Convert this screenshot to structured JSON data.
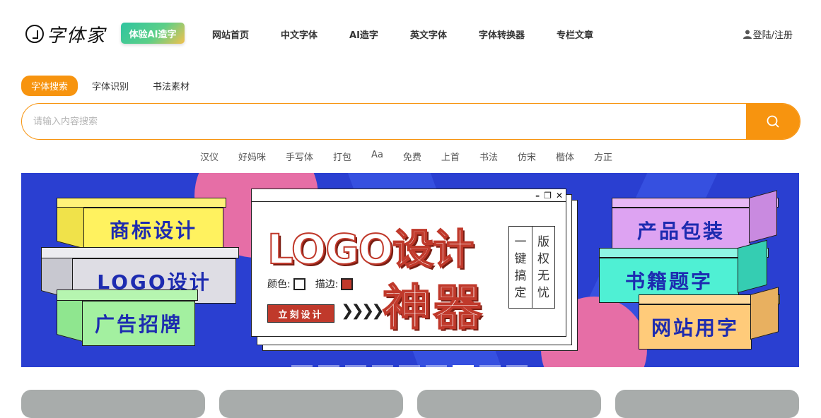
{
  "header": {
    "logo_text": "字体家",
    "ai_badge": "体验AI造字",
    "nav": [
      "网站首页",
      "中文字体",
      "AI造字",
      "英文字体",
      "字体转换器",
      "专栏文章"
    ],
    "login": "登陆/注册"
  },
  "search": {
    "tabs": [
      "字体搜索",
      "字体识别",
      "书法素材"
    ],
    "active_tab": 0,
    "placeholder": "请输入内容搜索",
    "hot_words": [
      "汉仪",
      "好妈咪",
      "手写体",
      "打包",
      "Aa",
      "免费",
      "上首",
      "书法",
      "仿宋",
      "楷体",
      "方正"
    ]
  },
  "banner": {
    "left_boxes": [
      "商标设计",
      "LOGO设计",
      "广告招牌"
    ],
    "right_boxes": [
      "产品包装",
      "书籍题字",
      "网站用字"
    ],
    "headline": "LOGO设计",
    "subhead": "神器",
    "color_label": "颜色:",
    "stroke_label": "描边:",
    "cta": "立刻设计",
    "arrows": "❯❯❯❯",
    "vertical_left": [
      "一",
      "键",
      "搞",
      "定"
    ],
    "vertical_right": [
      "版",
      "权",
      "无",
      "忧"
    ],
    "slide_count": 9,
    "active_slide": 6
  },
  "colors": {
    "accent": "#f7940f",
    "banner_bg": "#2a3fd1",
    "brand_red": "#c0392b"
  }
}
